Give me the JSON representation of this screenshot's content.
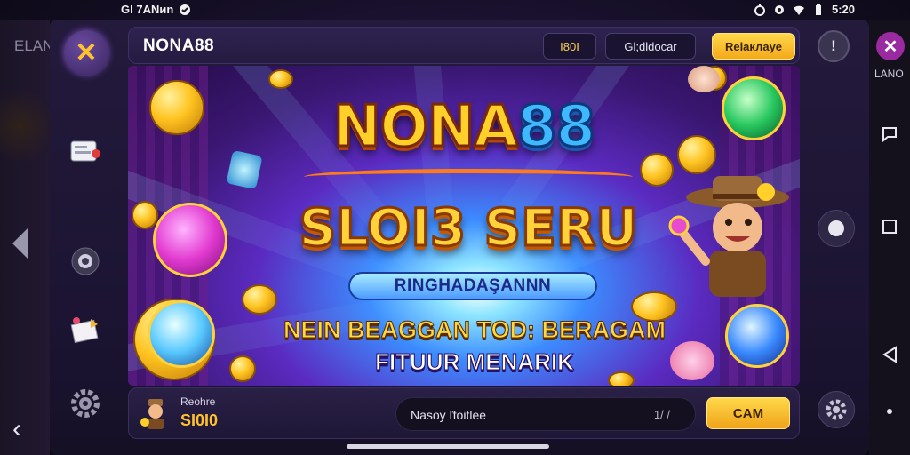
{
  "status_bar": {
    "left_text": "GI 7ANиn",
    "time": "5:20"
  },
  "outer_left": {
    "faded_label": "ELAN"
  },
  "outer_right": {
    "app_label": "LANO",
    "logo_glyph": "✕"
  },
  "app": {
    "brand": "NONA88",
    "topbar": {
      "coin_label": "I80I",
      "guide_label": "Gl;dldocar",
      "cta_label": "Relaклаye"
    },
    "info_glyph": "!",
    "banner": {
      "title_part1": "NONA",
      "title_part2": "88",
      "subtitle": "SLOI3 SERU",
      "tagline": "RINGHADAŞANNN",
      "line1": "NEIN BEAGGAN TOD: BERAGAM",
      "line2": "FITUUR MENARIK"
    },
    "bottom": {
      "balance_label": "Reohre",
      "balance_value": "SI0I0",
      "search_value": "Nasoy ľfoitlee",
      "search_suffix": "1/ /",
      "cta_label": "CAM"
    }
  },
  "icons": {
    "rail_logo": "lightning-icon",
    "rail": [
      "ticket-icon",
      "camera-icon",
      "gift-icon",
      "gear-icon"
    ],
    "right_rail": [
      "info-icon",
      "record-icon",
      "settings-icon"
    ],
    "system_nav": [
      "recent-icon",
      "square-icon",
      "triangle-back-icon",
      "dot-icon"
    ]
  },
  "colors": {
    "accent_gold": "#ffc22e",
    "banner_purple": "#5b2ac0",
    "cta_yellow": "#ffd84a"
  }
}
